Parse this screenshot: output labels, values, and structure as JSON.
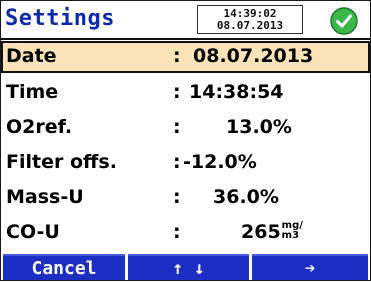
{
  "header": {
    "title": "Settings",
    "time": "14:39:02",
    "date": "08.07.2013",
    "status_icon": "check-circle-icon",
    "status_color": "#3cb84a"
  },
  "rows": [
    {
      "label": "Date",
      "colon": ":",
      "value": "08.07.2013",
      "selected": true
    },
    {
      "label": "Time",
      "colon": ":",
      "value": "14:38:54"
    },
    {
      "label": "O2ref.",
      "colon": ":",
      "value": "13.0%"
    },
    {
      "label": "Filter offs.",
      "colon": ":",
      "value": "-12.0%"
    },
    {
      "label": "Mass-U",
      "colon": ":",
      "value": "36.0%"
    },
    {
      "label": "CO-U",
      "colon": ":",
      "value": "265",
      "unit_top": "mg",
      "unit_bottom": "m3"
    }
  ],
  "softkeys": {
    "cancel": "Cancel",
    "updown": "↑ ↓",
    "next": "➔"
  },
  "colors": {
    "title": "#0f2aa8",
    "selected_row": "#fbe3b8",
    "softkey_bg": "#1d2ec2"
  }
}
